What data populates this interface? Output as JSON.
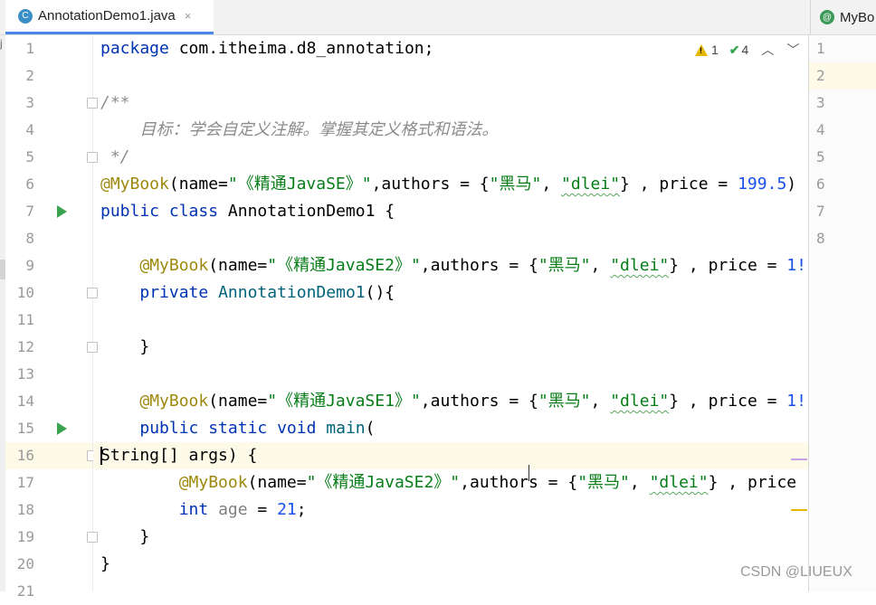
{
  "tabs": {
    "active": {
      "label": "AnnotationDemo1.java",
      "icon": "java-class-icon",
      "close": "×"
    },
    "right": {
      "label": "MyBo",
      "icon": "annotation-icon"
    }
  },
  "left_strip_label": "j",
  "inspections": {
    "warnings": "1",
    "weak_warnings": "4"
  },
  "colors": {
    "keyword": "#0033b3",
    "annotation": "#9e880d",
    "string": "#067d17",
    "number": "#1750eb",
    "comment": "#8c8c8c"
  },
  "lines": [
    {
      "n": "1",
      "segs": [
        [
          "kw",
          "package"
        ],
        [
          "pl",
          " com.itheima.d8_annotation;"
        ]
      ]
    },
    {
      "n": "2",
      "segs": []
    },
    {
      "n": "3",
      "fold": true,
      "segs": [
        [
          "cm",
          "/**"
        ]
      ]
    },
    {
      "n": "4",
      "segs": [
        [
          "cm",
          "    目标：学会自定义注解。掌握其定义格式和语法。"
        ]
      ]
    },
    {
      "n": "5",
      "fold": true,
      "segs": [
        [
          "cm",
          " */"
        ]
      ]
    },
    {
      "n": "6",
      "segs": [
        [
          "an",
          "@MyBook"
        ],
        [
          "pl",
          "(name="
        ],
        [
          "st",
          "\"《精通JavaSE》\""
        ],
        [
          "pl",
          ",authors = {"
        ],
        [
          "st",
          "\"黑马\""
        ],
        [
          "pl",
          ", "
        ],
        [
          "stw",
          "\"dlei\""
        ],
        [
          "pl",
          "} , price = "
        ],
        [
          "nm",
          "199.5"
        ],
        [
          "pl",
          ")"
        ]
      ]
    },
    {
      "n": "7",
      "run": true,
      "segs": [
        [
          "kw",
          "public class "
        ],
        [
          "pl",
          "AnnotationDemo1 {"
        ]
      ]
    },
    {
      "n": "8",
      "segs": []
    },
    {
      "n": "9",
      "segs": [
        [
          "pl",
          "    "
        ],
        [
          "an",
          "@MyBook"
        ],
        [
          "pl",
          "(name="
        ],
        [
          "st",
          "\"《精通JavaSE2》\""
        ],
        [
          "pl",
          ",authors = {"
        ],
        [
          "st",
          "\"黑马\""
        ],
        [
          "pl",
          ", "
        ],
        [
          "stw",
          "\"dlei\""
        ],
        [
          "pl",
          "} , price = "
        ],
        [
          "nm",
          "1!"
        ]
      ]
    },
    {
      "n": "10",
      "fold": true,
      "segs": [
        [
          "pl",
          "    "
        ],
        [
          "kw",
          "private "
        ],
        [
          "fn",
          "AnnotationDemo1"
        ],
        [
          "pl",
          "(){"
        ]
      ]
    },
    {
      "n": "11",
      "segs": []
    },
    {
      "n": "12",
      "fold": true,
      "segs": [
        [
          "pl",
          "    }"
        ]
      ]
    },
    {
      "n": "13",
      "segs": []
    },
    {
      "n": "14",
      "segs": [
        [
          "pl",
          "    "
        ],
        [
          "an",
          "@MyBook"
        ],
        [
          "pl",
          "(name="
        ],
        [
          "st",
          "\"《精通JavaSE1》\""
        ],
        [
          "pl",
          ",authors = {"
        ],
        [
          "st",
          "\"黑马\""
        ],
        [
          "pl",
          ", "
        ],
        [
          "stw",
          "\"dlei\""
        ],
        [
          "pl",
          "} , price = "
        ],
        [
          "nm",
          "1!"
        ]
      ]
    },
    {
      "n": "15",
      "run": true,
      "segs": [
        [
          "pl",
          "    "
        ],
        [
          "kw",
          "public static void "
        ],
        [
          "fn",
          "main"
        ],
        [
          "pl",
          "("
        ]
      ]
    },
    {
      "n": "16",
      "fold": true,
      "highlight": true,
      "segs": [
        [
          "cur",
          ""
        ],
        [
          "pl",
          "String[] args) {"
        ]
      ]
    },
    {
      "n": "17",
      "segs": [
        [
          "pl",
          "        "
        ],
        [
          "an",
          "@MyBook"
        ],
        [
          "pl",
          "(name="
        ],
        [
          "st",
          "\"《精通JavaSE2》\""
        ],
        [
          "pl",
          ",authors = {"
        ],
        [
          "st",
          "\"黑马\""
        ],
        [
          "pl",
          ", "
        ],
        [
          "stw",
          "\"dlei\""
        ],
        [
          "pl",
          "} , price"
        ]
      ]
    },
    {
      "n": "18",
      "segs": [
        [
          "pl",
          "        "
        ],
        [
          "kw",
          "int "
        ],
        [
          "gray",
          "age"
        ],
        [
          "pl",
          " = "
        ],
        [
          "nm",
          "21"
        ],
        [
          "pl",
          ";"
        ]
      ]
    },
    {
      "n": "19",
      "fold": true,
      "segs": [
        [
          "pl",
          "    }"
        ]
      ]
    },
    {
      "n": "20",
      "segs": [
        [
          "pl",
          "}"
        ]
      ]
    },
    {
      "n": "21",
      "segs": []
    }
  ],
  "right_lines": [
    "1",
    "2",
    "3",
    "4",
    "5",
    "6",
    "7",
    "8"
  ],
  "watermark": "CSDN @LIUEUX"
}
